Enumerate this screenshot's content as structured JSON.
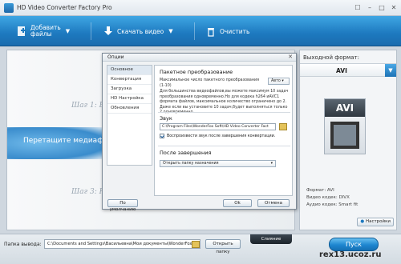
{
  "window": {
    "title": "HD Video Converter Factory Pro",
    "controls": [
      "☐",
      "–",
      "□",
      "✕"
    ]
  },
  "toolbar": {
    "add_files": "Добавить\nфайлы",
    "download_video": "Скачать видео",
    "clear": "Очистить"
  },
  "workspace": {
    "step1": "Шаг 1: Выбер",
    "step3": "Шаг 3: На",
    "drag_hint": "Перетащите медиаф"
  },
  "right_panel": {
    "title": "Выходной формат:",
    "format": "AVI",
    "icon_label": "AVI",
    "specs": [
      "Формат: AVI",
      "Видео кодек: DIVX",
      "Аудио кодек: Smart fit"
    ],
    "settings_button": "Настройки"
  },
  "bottom": {
    "output_label": "Папка вывода:",
    "output_path": "C:\\Documents and Settings\\Васильевна\\Мои документы\\WonderFox Soft\\",
    "open_folder": "Открыть папку",
    "merge": "Слияние",
    "run": "Пуск"
  },
  "dialog": {
    "title": "Опции",
    "nav": [
      "Основное",
      "Конвертация",
      "Загрузка",
      "HD Настройка",
      "Обновления"
    ],
    "active_nav": 0,
    "batch": {
      "title": "Пакетное преобразование",
      "max_label": "Максимальное число пакетного преобразования (1-10)",
      "max_value": "Авто",
      "info": "Для большинства видеофайлов,вы можете максимум 10 задач преобразования одновременно.Но для кодека h264 иAVC1 формата файлов, максимальное количество ограничено до 2. Даже если вы установите 10 задач,будет выполняться только 2 одновременно"
    },
    "sound": {
      "title": "Звук",
      "path": "C:\\Program Files\\WonderFox Soft\\HD Video Converter Fact",
      "play_sound": "Воспроизвести звук после завершения конвертации."
    },
    "after": {
      "title": "После завершения",
      "action": "Открыть папку назначения"
    },
    "buttons": {
      "default": "По умолчанию",
      "ok": "Ok",
      "cancel": "Отмена"
    }
  },
  "watermark": "rex13.ucoz.ru",
  "colors": {
    "toolbar": "#1d79bf",
    "accent": "#3fa6e3",
    "dialog_bg": "#f0f2f4"
  }
}
